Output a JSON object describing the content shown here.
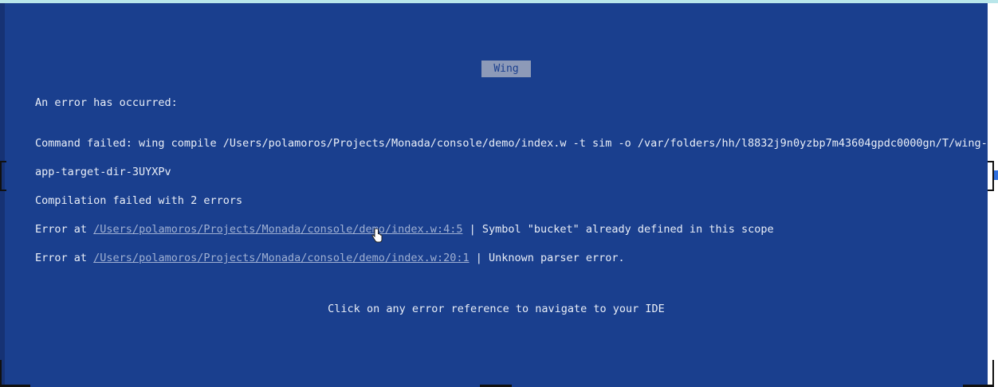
{
  "dialog": {
    "title": "Wing",
    "heading": "An error has occurred:",
    "command_line_1": "Command failed: wing compile /Users/polamoros/Projects/Monada/console/demo/index.w -t sim -o /var/folders/hh/l8832j9n0yzbp7m43604gpdc0000gn/T/wing-",
    "command_line_2": "app-target-dir-3UYXPv",
    "summary": "Compilation failed with 2 errors",
    "errors": [
      {
        "prefix": "Error at",
        "link": "/Users/polamoros/Projects/Monada/console/demo/index.w:4:5",
        "message": "| Symbol \"bucket\" already defined in this scope"
      },
      {
        "prefix": "Error at",
        "link": "/Users/polamoros/Projects/Monada/console/demo/index.w:20:1",
        "message": "| Unknown parser error."
      }
    ],
    "hint": "Click on any error reference to navigate to your IDE"
  },
  "colors": {
    "background": "#1a3f8e",
    "text": "#e9eef7",
    "link": "#9fb0d3",
    "title_badge": "#8d9ab8"
  },
  "icons": {
    "pointer": "hand-pointer-cursor-icon"
  }
}
